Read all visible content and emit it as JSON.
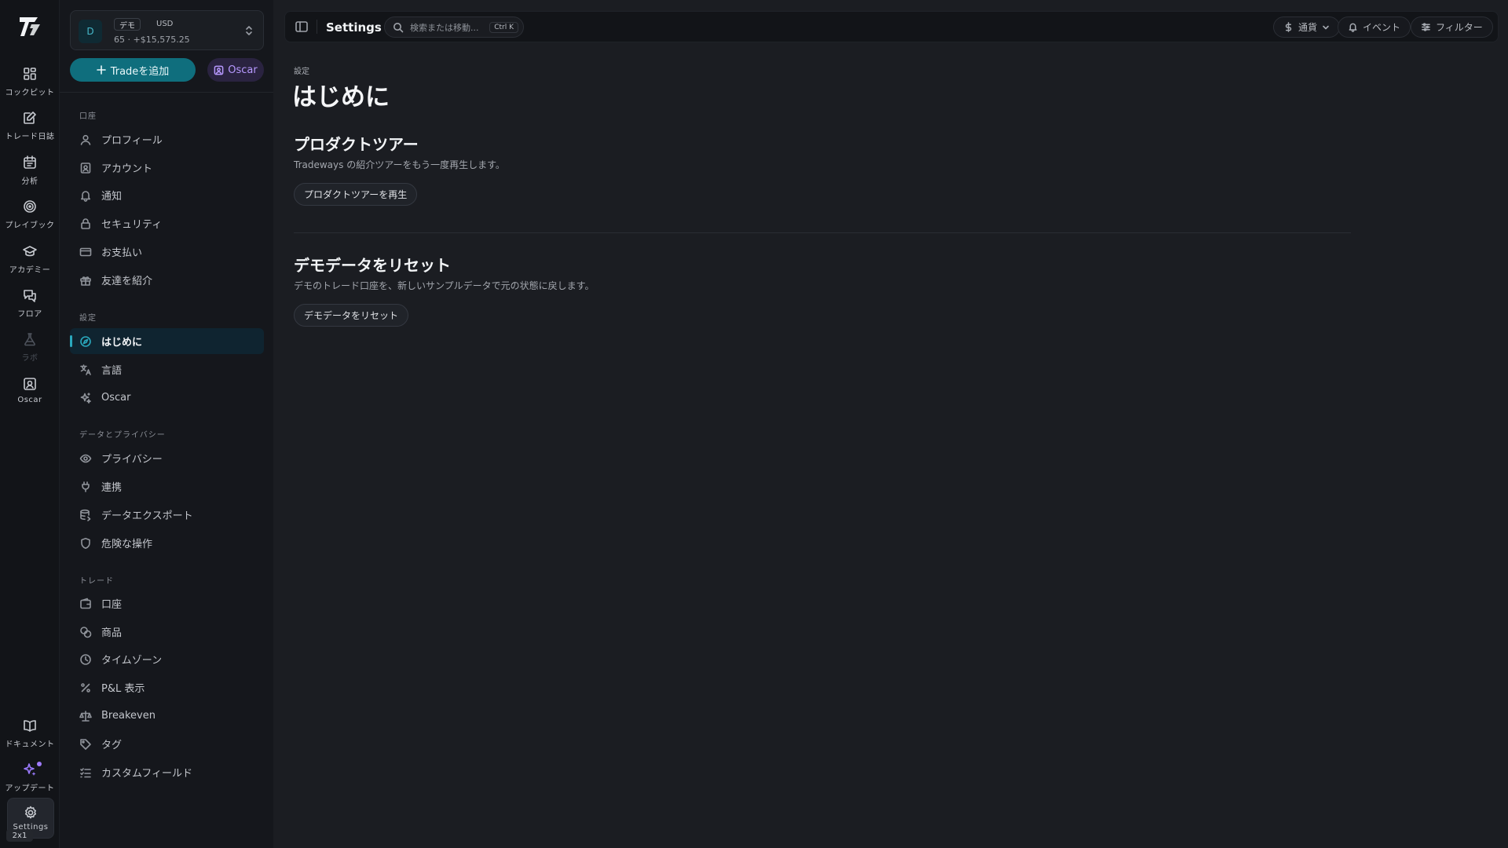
{
  "rail": {
    "items": [
      {
        "label": "コックピット",
        "icon": "dashboard-icon"
      },
      {
        "label": "トレード日誌",
        "icon": "journal-icon"
      },
      {
        "label": "分析",
        "icon": "calendar-icon"
      },
      {
        "label": "プレイブック",
        "icon": "target-icon"
      },
      {
        "label": "アカデミー",
        "icon": "graduation-cap-icon"
      },
      {
        "label": "フロア",
        "icon": "chat-icon"
      },
      {
        "label": "ラボ",
        "icon": "flask-icon"
      },
      {
        "label": "Oscar",
        "icon": "oscar-icon"
      }
    ],
    "bottom": [
      {
        "label": "ドキュメント",
        "icon": "book-icon"
      },
      {
        "label": "アップデート",
        "icon": "sparkles-icon"
      },
      {
        "label": "Settings",
        "icon": "gear-icon"
      }
    ],
    "badge": "2x1"
  },
  "account": {
    "avatar": "D",
    "tag": "デモ",
    "currency": "USD",
    "summary": "65 · +$15,575.25"
  },
  "actions": {
    "add_trade": "Tradeを追加",
    "oscar": "Oscar"
  },
  "sidebar": {
    "groups": [
      {
        "label": "口座",
        "items": [
          "プロフィール",
          "アカウント",
          "通知",
          "セキュリティ",
          "お支払い",
          "友達を紹介"
        ]
      },
      {
        "label": "設定",
        "items": [
          "はじめに",
          "言語",
          "Oscar"
        ]
      },
      {
        "label": "データとプライバシー",
        "items": [
          "プライバシー",
          "連携",
          "データエクスポート",
          "危険な操作"
        ]
      },
      {
        "label": "トレード",
        "items": [
          "口座",
          "商品",
          "タイムゾーン",
          "P&L 表示",
          "Breakeven",
          "タグ",
          "カスタムフィールド"
        ]
      }
    ]
  },
  "topbar": {
    "title": "Settings",
    "search_placeholder": "検索または移動...",
    "shortcut": "Ctrl K",
    "currency": "通貨",
    "events": "イベント",
    "filter": "フィルター"
  },
  "page": {
    "breadcrumb": "設定",
    "title": "はじめに",
    "sections": [
      {
        "title": "プロダクトツアー",
        "desc": "Tradeways の紹介ツアーをもう一度再生します。",
        "button": "プロダクトツアーを再生"
      },
      {
        "title": "デモデータをリセット",
        "desc": "デモのトレード口座を、新しいサンプルデータで元の状態に戻します。",
        "button": "デモデータをリセット"
      }
    ]
  },
  "colors": {
    "accent": "#0f6e7d",
    "accent_bright": "#2aa8bd",
    "oscar": "#b799ff",
    "background": "#1b1d22"
  }
}
